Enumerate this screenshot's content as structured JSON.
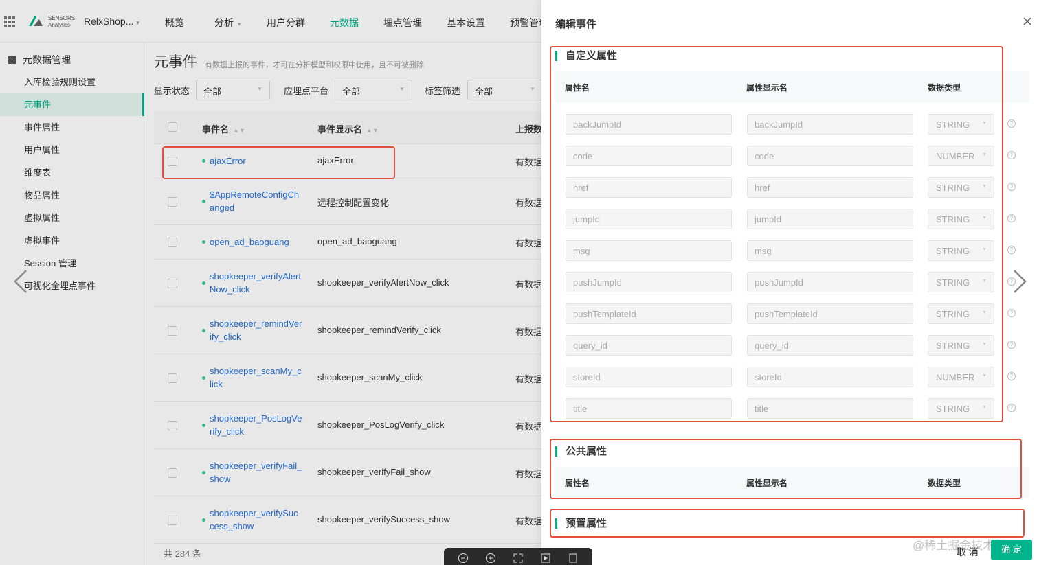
{
  "nav": {
    "logo_line1": "SENSORS",
    "logo_line2": "Analytics",
    "project": "RelxShop...",
    "items": [
      "概览",
      "分析",
      "用户分群",
      "元数据",
      "埋点管理",
      "基本设置",
      "预警管理"
    ],
    "active_index": 3
  },
  "sidebar": {
    "heading": "元数据管理",
    "items": [
      "入库检验规则设置",
      "元事件",
      "事件属性",
      "用户属性",
      "维度表",
      "物品属性",
      "虚拟属性",
      "虚拟事件",
      "Session 管理",
      "可视化全埋点事件"
    ],
    "active_index": 1
  },
  "main": {
    "title": "元事件",
    "description": "有数据上报的事件，才可在分析模型和权限中使用，且不可被删除",
    "filters": [
      {
        "label": "显示状态",
        "value": "全部"
      },
      {
        "label": "应埋点平台",
        "value": "全部"
      },
      {
        "label": "标签筛选",
        "value": "全部"
      }
    ],
    "columns": [
      "事件名",
      "事件显示名",
      "上报数据"
    ],
    "rows": [
      {
        "name": "ajaxError",
        "display": "ajaxError",
        "status": "有数据"
      },
      {
        "name": "$AppRemoteConfigChanged",
        "display": "远程控制配置变化",
        "status": "有数据"
      },
      {
        "name": "open_ad_baoguang",
        "display": "open_ad_baoguang",
        "status": "有数据"
      },
      {
        "name": "shopkeeper_verifyAlertNow_click",
        "display": "shopkeeper_verifyAlertNow_click",
        "status": "有数据"
      },
      {
        "name": "shopkeeper_remindVerify_click",
        "display": "shopkeeper_remindVerify_click",
        "status": "有数据"
      },
      {
        "name": "shopkeeper_scanMy_click",
        "display": "shopkeeper_scanMy_click",
        "status": "有数据"
      },
      {
        "name": "shopkeeper_PosLogVerify_click",
        "display": "shopkeeper_PosLogVerify_click",
        "status": "有数据"
      },
      {
        "name": "shopkeeper_verifyFail_show",
        "display": "shopkeeper_verifyFail_show",
        "status": "有数据"
      },
      {
        "name": "shopkeeper_verifySuccess_show",
        "display": "shopkeeper_verifySuccess_show",
        "status": "有数据"
      }
    ],
    "total": "共 284 条"
  },
  "drawer": {
    "title": "编辑事件",
    "custom_section": "自定义属性",
    "public_section": "公共属性",
    "preset_section": "预置属性",
    "col_name": "属性名",
    "col_display": "属性显示名",
    "col_type": "数据类型",
    "properties": [
      {
        "name": "backJumpId",
        "display": "backJumpId",
        "type": "STRING"
      },
      {
        "name": "code",
        "display": "code",
        "type": "NUMBER"
      },
      {
        "name": "href",
        "display": "href",
        "type": "STRING"
      },
      {
        "name": "jumpId",
        "display": "jumpId",
        "type": "STRING"
      },
      {
        "name": "msg",
        "display": "msg",
        "type": "STRING"
      },
      {
        "name": "pushJumpId",
        "display": "pushJumpId",
        "type": "STRING"
      },
      {
        "name": "pushTemplateId",
        "display": "pushTemplateId",
        "type": "STRING"
      },
      {
        "name": "query_id",
        "display": "query_id",
        "type": "STRING"
      },
      {
        "name": "storeId",
        "display": "storeId",
        "type": "NUMBER"
      },
      {
        "name": "title",
        "display": "title",
        "type": "STRING"
      }
    ],
    "cancel": "取 消",
    "ok": "确 定"
  },
  "watermark": "@稀土掘金技术社区",
  "colors": {
    "accent": "#00b48c",
    "link": "#2673e0",
    "highlight": "#e0503c"
  }
}
